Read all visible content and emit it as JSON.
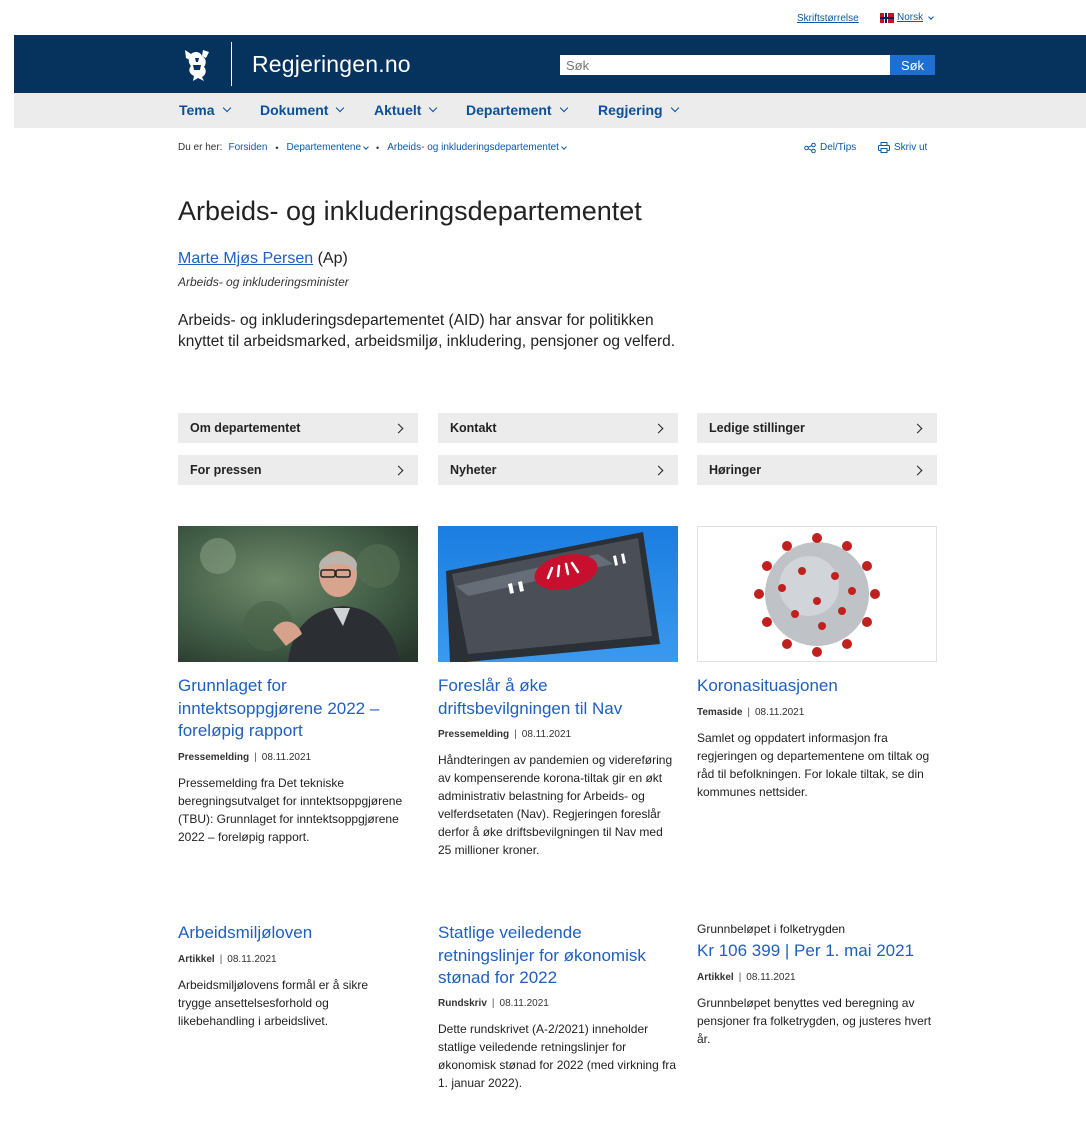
{
  "utility": {
    "font_size_label": "Skriftstørrelse",
    "language_label": "Norsk"
  },
  "header": {
    "site_name": "Regjeringen.no",
    "search_placeholder": "Søk",
    "search_button": "Søk"
  },
  "nav": [
    {
      "label": "Tema"
    },
    {
      "label": "Dokument"
    },
    {
      "label": "Aktuelt"
    },
    {
      "label": "Departement"
    },
    {
      "label": "Regjering"
    }
  ],
  "breadcrumb": {
    "prefix": "Du er her:",
    "items": [
      "Forsiden",
      "Departementene",
      "Arbeids- og inkluderingsdepartementet"
    ]
  },
  "tools": {
    "share_label": "Del/Tips",
    "print_label": "Skriv ut"
  },
  "page": {
    "title": "Arbeids- og inkluderingsdepartementet",
    "minister_name": "Marte Mjøs Persen",
    "minister_party": " (Ap)",
    "minister_role": "Arbeids- og inkluderingsminister",
    "intro": "Arbeids- og inkluderingsdepartementet (AID) har ansvar for politikken knyttet til arbeidsmarked, arbeidsmiljø, inkludering, pensjoner og velferd."
  },
  "quicklinks": [
    "Om departementet",
    "Kontakt",
    "Ledige stillinger",
    "For pressen",
    "Nyheter",
    "Høringer"
  ],
  "cards": [
    {
      "title": "Grunnlaget for inntektsoppgjørene 2022 – foreløpig rapport",
      "type": "Pressemelding",
      "date": "08.11.2021",
      "text": "Pressemelding fra Det tekniske beregningsutvalget for inntektsoppgjørene (TBU): Grunnlaget for inntektsoppgjørene 2022 – foreløpig rapport."
    },
    {
      "title": "Foreslår å øke driftsbevilgningen til Nav",
      "type": "Pressemelding",
      "date": "08.11.2021",
      "text": "Håndteringen av pandemien og videreføring av kompenserende korona-tiltak gir en økt administrativ belastning for Arbeids- og velferdsetaten (Nav). Regjeringen foreslår derfor å øke driftsbevilgningen til Nav med 25 millioner kroner."
    },
    {
      "title": "Koronasituasjonen",
      "type": "Temaside",
      "date": "08.11.2021",
      "text": "Samlet og oppdatert informasjon fra regjeringen og departementene om tiltak og råd til befolkningen. For lokale tiltak, se din kommunes nettsider."
    },
    {
      "title": "Arbeidsmiljøloven",
      "type": "Artikkel",
      "date": "08.11.2021",
      "text": "Arbeidsmiljølovens formål er å sikre trygge ansettelsesforhold og likebehandling i arbeidslivet."
    },
    {
      "title": "Statlige veiledende retningslinjer for økonomisk stønad for 2022",
      "type": "Rundskriv",
      "date": "08.11.2021",
      "text": "Dette rundskrivet (A-2/2021) inneholder statlige veiledende retningslinjer for økonomisk stønad for 2022 (med virkning fra 1. januar 2022)."
    },
    {
      "kicker": "Grunnbeløpet i folketrygden",
      "title": "Kr 106 399 | Per 1. mai 2021",
      "type": "Artikkel",
      "date": "08.11.2021",
      "text": "Grunnbeløpet benyttes ved beregning av pensjoner fra folketrygden, og justeres hvert år."
    }
  ],
  "colors": {
    "header": "#06325e",
    "nav_bg": "#ececec",
    "link": "#1f5fbf",
    "search_button": "#1f6fd0"
  },
  "icons": {
    "logo": "royal-lion-icon",
    "share": "share-icon",
    "print": "printer-icon",
    "flag": "norway-flag-icon"
  }
}
